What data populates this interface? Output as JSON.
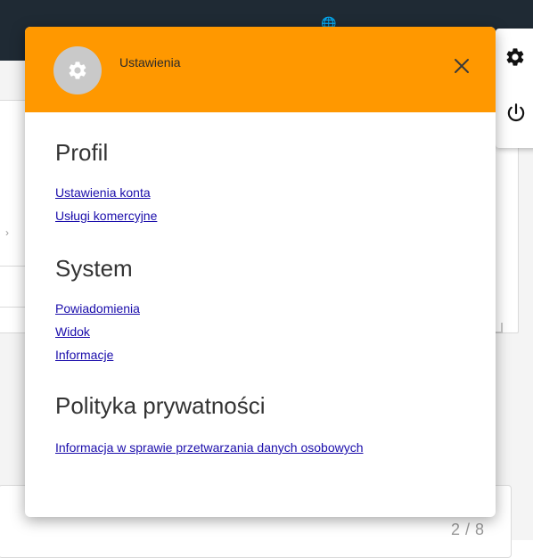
{
  "dialog": {
    "title": "Ustawienia",
    "sections": [
      {
        "heading": "Profil",
        "links": [
          "Ustawienia konta",
          "Usługi komercyjne"
        ]
      },
      {
        "heading": "System",
        "links": [
          "Powiadomienia",
          "Widok",
          "Informacje"
        ]
      },
      {
        "heading": "Polityka prywatności",
        "links": [
          "Informacja w sprawie przetwarzania danych osobowych"
        ]
      }
    ]
  },
  "background": {
    "page_counter": "2 / 8"
  },
  "icons": {
    "avatar": "gear-icon",
    "close": "close-icon",
    "side_top": "gear-icon",
    "side_bottom": "power-icon"
  },
  "colors": {
    "header": "#ff9800",
    "link": "#1a0dab",
    "topbar": "#1f2a34"
  }
}
